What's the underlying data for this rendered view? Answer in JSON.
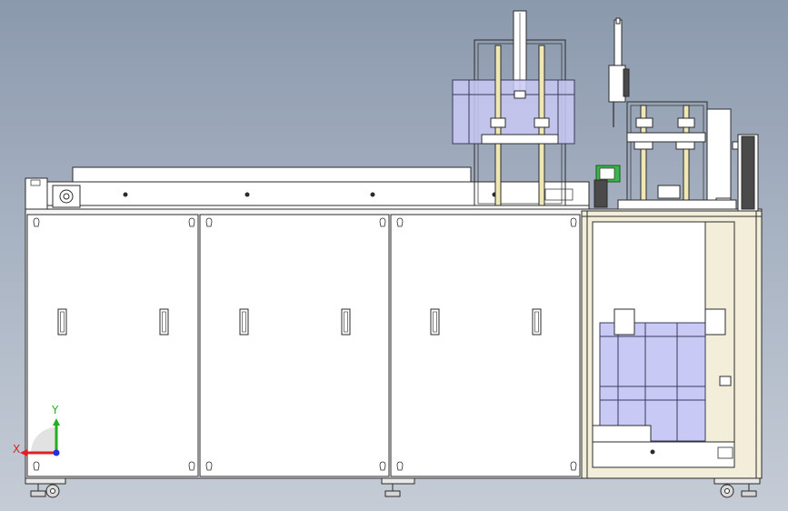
{
  "viewport": {
    "background_top": "#8b99ad",
    "background_bottom": "#c5ccd6"
  },
  "colors": {
    "panel_fill": "#ffffff",
    "outline": "#2b2b2b",
    "frame_beige": "#f3eed9",
    "glass_blue": "#c9c9f5",
    "shaft_cream": "#efe7b4",
    "green_part": "#3cb44b",
    "dark_part": "#4a4a4a"
  },
  "triad": {
    "x_label": "X",
    "y_label": "Y",
    "x_color": "#e02020",
    "y_color": "#20b020",
    "z_color": "#2030e0"
  },
  "model": {
    "cabinet_doors": 3,
    "door_handles_per_door": 2,
    "open_bay": "right",
    "casters": 4
  }
}
